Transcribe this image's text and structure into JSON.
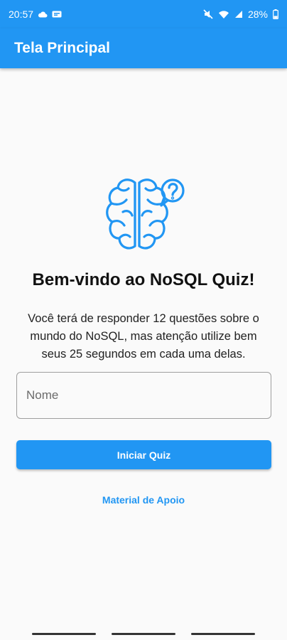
{
  "status_bar": {
    "time": "20:57",
    "battery": "28%",
    "icons": [
      "cloud-icon",
      "notification-icon",
      "mute-icon",
      "wifi-icon",
      "signal-icon",
      "battery-icon"
    ]
  },
  "app_bar": {
    "title": "Tela Principal"
  },
  "main": {
    "illustration": "brain-question-icon",
    "welcome_title": "Bem-vindo ao NoSQL Quiz!",
    "description_lines": [
      "Você terá de responder 12 questões sobre o",
      "mundo do NoSQL, mas atenção utilize bem",
      "seus 25 segundos em cada uma delas."
    ],
    "name_input": {
      "placeholder": "Nome",
      "value": ""
    },
    "start_button_label": "Iniciar Quiz",
    "support_link_label": "Material de Apoio"
  },
  "colors": {
    "primary": "#2196f3",
    "background": "#fafafa",
    "text": "#111111"
  }
}
